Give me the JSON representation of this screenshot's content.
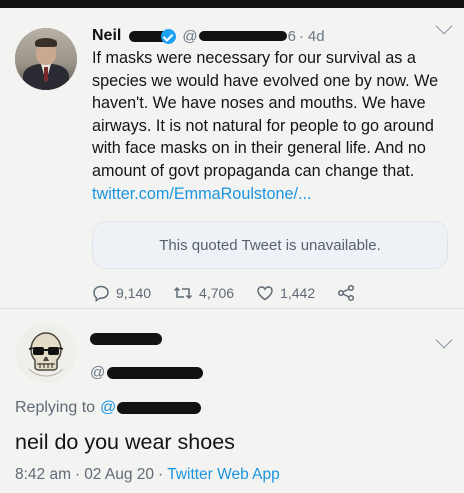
{
  "tweet": {
    "author_name": "Neil",
    "handle_prefix": "@",
    "handle_suffix": "6",
    "separator": "·",
    "time_ago": "4d",
    "text": "If masks were necessary for our survival as a species we would have evolved one by now. We haven't. We have noses and mouths. We have airways. It is not natural for people to go around with face masks on in their general life. And no amount of govt propaganda can change that.",
    "link_text": "twitter.com/EmmaRoulstone/...",
    "quoted_tweet_text": "This quoted Tweet is unavailable.",
    "replies_count": "9,140",
    "retweets_count": "4,706",
    "likes_count": "1,442",
    "icons": [
      "verified-badge-icon",
      "chevron-down-icon",
      "reply-icon",
      "retweet-icon",
      "like-heart-icon",
      "share-icon"
    ]
  },
  "reply": {
    "handle_prefix": "@",
    "replying_to_label": "Replying to",
    "replying_to_handle_prefix": "@",
    "text": "neil do you wear shoes",
    "time": "8:42 am",
    "separator": "·",
    "date": "02 Aug 20",
    "source_app": "Twitter Web App",
    "icons": [
      "skull-avatar-icon",
      "chevron-down-icon"
    ]
  },
  "colors": {
    "link_blue": "#1b95e0",
    "verified_blue": "#1da1f2",
    "muted_gray": "#687684"
  }
}
